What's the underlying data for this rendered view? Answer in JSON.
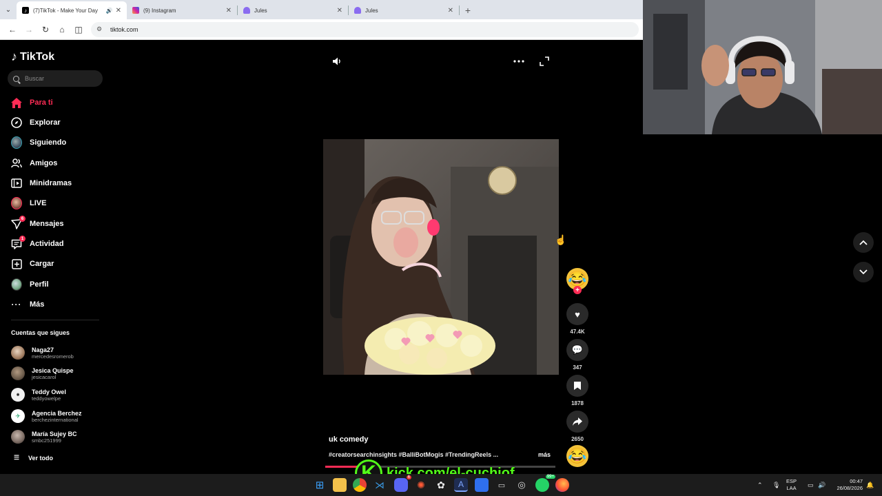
{
  "browser": {
    "tabs": [
      {
        "label": "(7)TikTok - Make Your Day",
        "active": true,
        "icon": "tiktok-icon",
        "audible": true
      },
      {
        "label": "(9) Instagram",
        "active": false,
        "icon": "instagram-icon"
      },
      {
        "label": "Jules",
        "active": false,
        "icon": "jules-icon"
      },
      {
        "label": "Jules",
        "active": false,
        "icon": "jules-icon"
      }
    ],
    "new_tab": "+",
    "url": "tiktok.com"
  },
  "sidebar": {
    "logo": "TikTok",
    "search_placeholder": "Buscar",
    "nav": [
      {
        "label": "Para ti",
        "icon": "home-icon",
        "active": true
      },
      {
        "label": "Explorar",
        "icon": "compass-icon"
      },
      {
        "label": "Siguiendo",
        "icon": "following-avatar-icon"
      },
      {
        "label": "Amigos",
        "icon": "friends-icon"
      },
      {
        "label": "Minidramas",
        "icon": "film-icon"
      },
      {
        "label": "LIVE",
        "icon": "live-avatar-icon"
      },
      {
        "label": "Mensajes",
        "icon": "send-icon",
        "badge": "6"
      },
      {
        "label": "Actividad",
        "icon": "activity-icon",
        "badge": "1"
      },
      {
        "label": "Cargar",
        "icon": "upload-icon"
      },
      {
        "label": "Perfil",
        "icon": "profile-avatar-icon"
      },
      {
        "label": "Más",
        "icon": "more-dots-icon"
      }
    ],
    "following_title": "Cuentas que sigues",
    "accounts": [
      {
        "name": "Naga27",
        "handle": "mercedesromerob",
        "color": "#c9b59a"
      },
      {
        "name": "Jesica Quispe",
        "handle": "jesicacarol",
        "color": "#7a6a5a"
      },
      {
        "name": "Teddy Owel",
        "handle": "teddyowelpe",
        "color": "#e8e8e8"
      },
      {
        "name": "Agencia Berchez",
        "handle": "berchezinternational",
        "color": "#ffffff"
      },
      {
        "name": "María Sujey BC",
        "handle": "smbc251999",
        "color": "#8a7f78"
      }
    ],
    "see_all": "Ver todo"
  },
  "video": {
    "caption_title": "uk comedy",
    "hashtags": "#creatorsearchinsights #BalliBotMogis #TrendingReels ...",
    "more_label": "más",
    "likes": "47.4K",
    "comments": "347",
    "saves": "1878",
    "shares": "2650",
    "progress_fraction": 0.21
  },
  "overlay": {
    "kick_letter": "K",
    "kick_url": "kick.com/el-cuchiof"
  },
  "taskbar": {
    "lang_top": "ESP",
    "lang_bottom": "LAA",
    "time": "00:47",
    "date": "26/08/2026",
    "discord_badge": "6",
    "whatsapp_badge": "99+"
  },
  "colors": {
    "accent": "#fe2c55",
    "kick_green": "#53fc18"
  }
}
